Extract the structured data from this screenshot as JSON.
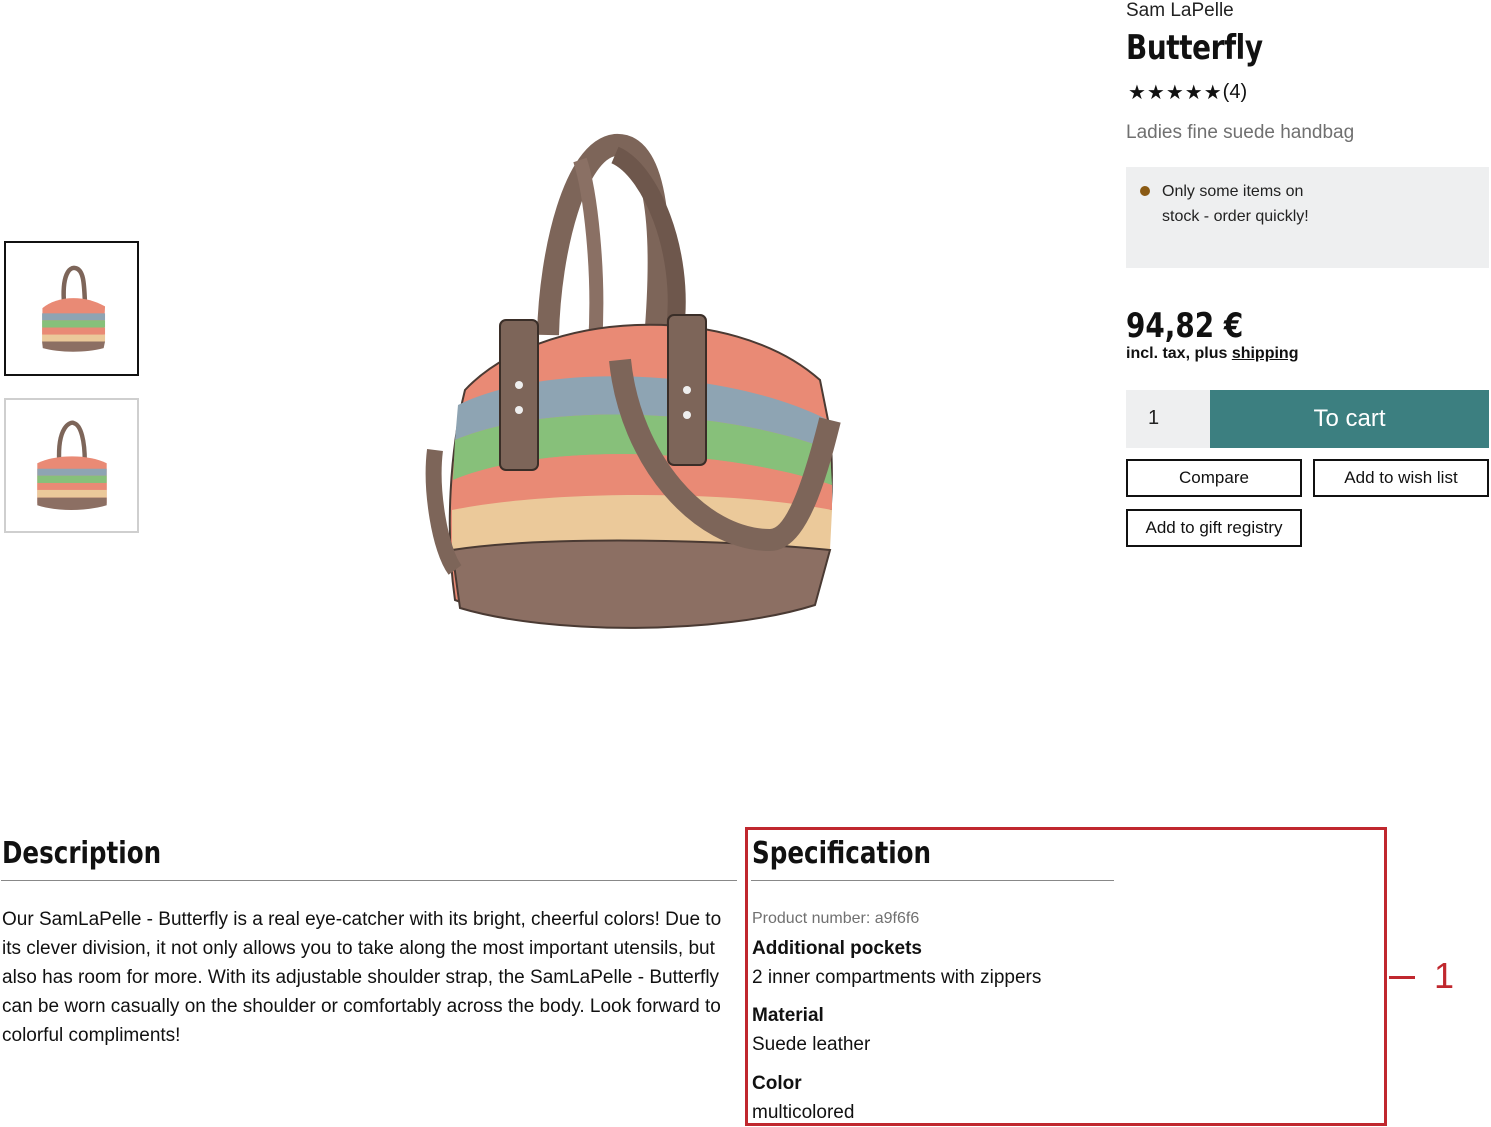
{
  "product": {
    "brand": "Sam LaPelle",
    "name": "Butterfly",
    "stars": "★★★★★",
    "review_count": "(4)",
    "rating": 5,
    "subtitle": "Ladies fine suede handbag"
  },
  "stock": {
    "message": "Only some items on stock - order quickly!",
    "dot_color": "#8a5a14"
  },
  "pricing": {
    "price": "94,82 €",
    "tax_prefix": "incl. tax, plus ",
    "shipping_link": "shipping"
  },
  "purchase": {
    "quantity": "1",
    "cart_label": "To cart",
    "compare_label": "Compare",
    "wishlist_label": "Add to wish list",
    "gift_label": "Add to gift registry",
    "accent_color": "#3c7f80"
  },
  "description": {
    "heading": "Description",
    "text": "Our SamLaPelle - Butterfly is a real eye-catcher with its bright, cheerful colors! Due to its clever division, it not only allows you to take along the most important utensils, but also has room for more. With its adjustable shoulder strap, the SamLaPelle - Butterfly can be worn casually on the shoulder or comfortably across the body. Look forward to colorful compliments!"
  },
  "specification": {
    "heading": "Specification",
    "product_number": "Product number: a9f6f6",
    "items": [
      {
        "label": "Additional pockets",
        "value": "2 inner compartments with zippers"
      },
      {
        "label": "Material",
        "value": "Suede leather"
      },
      {
        "label": "Color",
        "value": "multicolored"
      }
    ]
  },
  "annotation": {
    "number": "1",
    "color": "#c0282e"
  }
}
